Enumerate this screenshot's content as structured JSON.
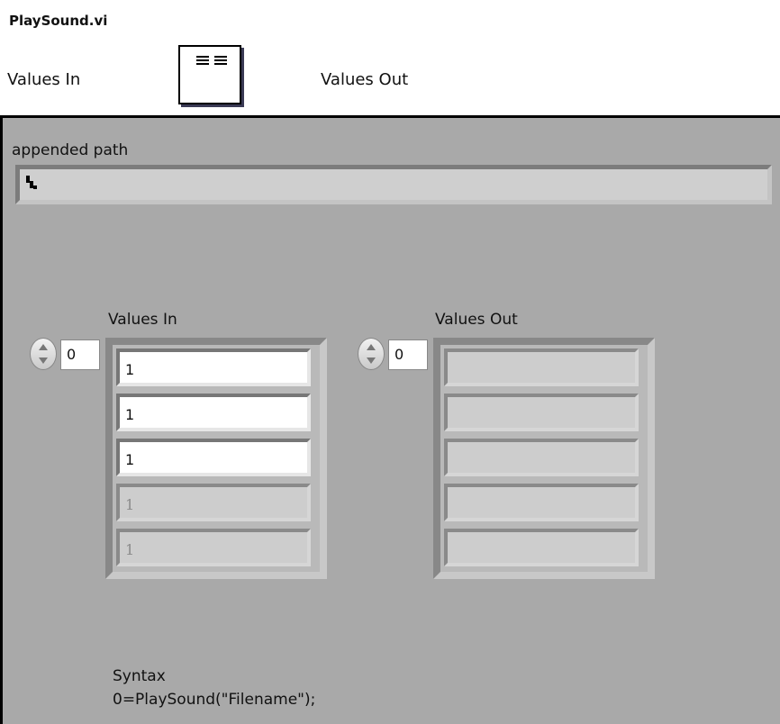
{
  "vi": {
    "title": "PlaySound.vi",
    "connector": {
      "left_label": "Values In",
      "right_label": "Values Out"
    },
    "icon": "array-to-array-icon"
  },
  "front_panel": {
    "path": {
      "label": "appended path",
      "value": "",
      "icon": "path-icon"
    },
    "values_in": {
      "label": "Values In",
      "index": "0",
      "elements": [
        "1",
        "1",
        "1",
        "1",
        "1"
      ],
      "defined_count": 3
    },
    "values_out": {
      "label": "Values Out",
      "index": "0",
      "elements": [
        "",
        "",
        "",
        "",
        ""
      ]
    },
    "syntax": {
      "title": "Syntax",
      "call": "0=PlaySound(\"Filename\");"
    }
  }
}
